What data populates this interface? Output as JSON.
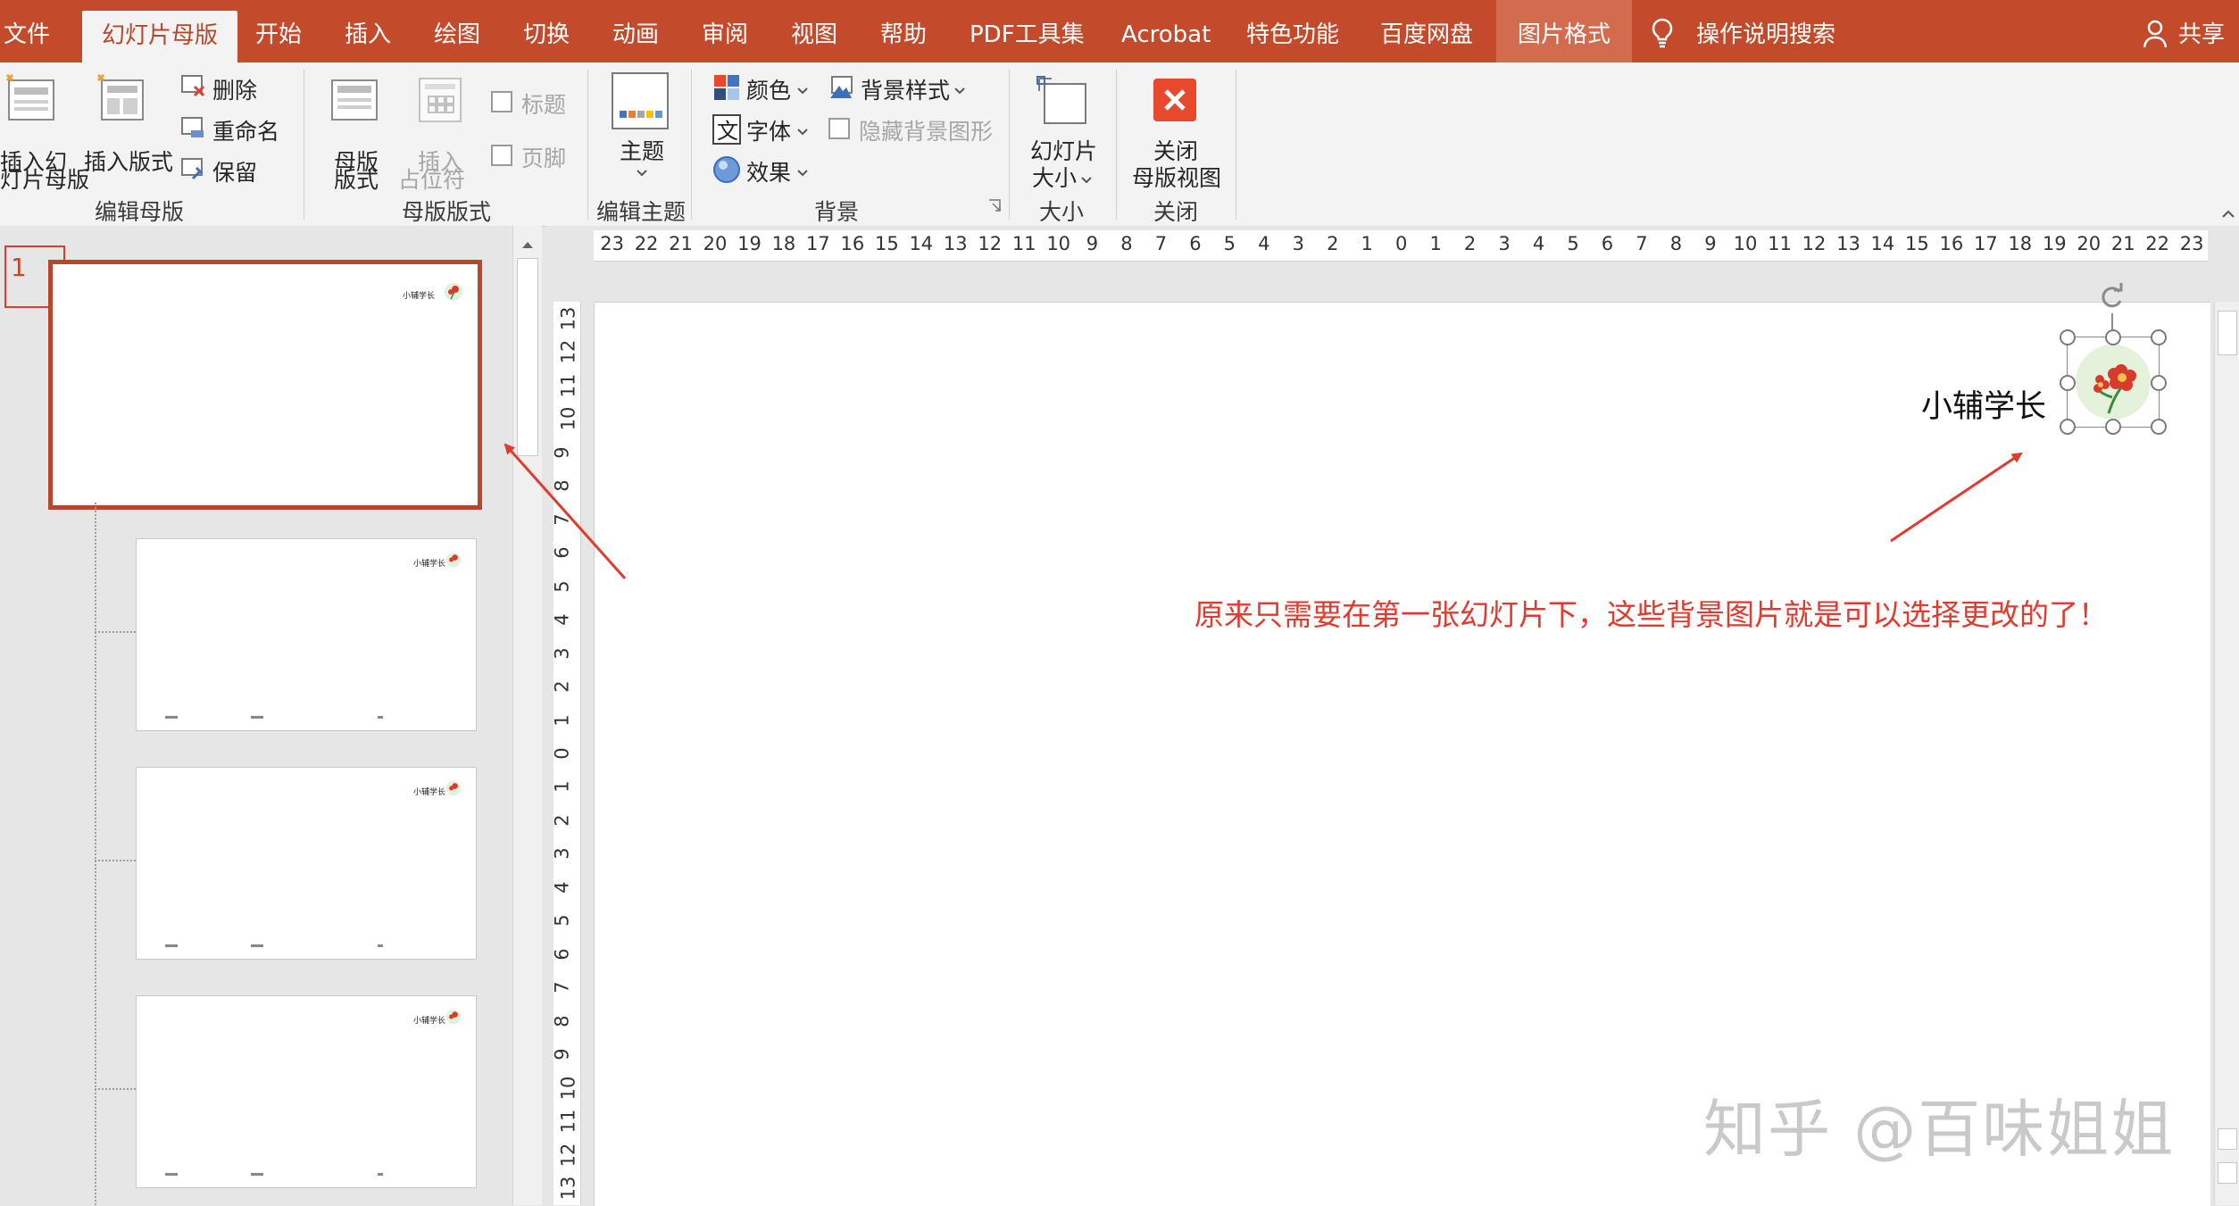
{
  "tabs": {
    "file": "文件",
    "slide_master": "幻灯片母版",
    "home": "开始",
    "insert": "插入",
    "draw": "绘图",
    "transitions": "切换",
    "animations": "动画",
    "review": "审阅",
    "view": "视图",
    "help": "帮助",
    "pdf_tools": "PDF工具集",
    "acrobat": "Acrobat",
    "special": "特色功能",
    "baidu": "百度网盘",
    "picture_format": "图片格式",
    "tell_me": "操作说明搜索",
    "share": "共享"
  },
  "ribbon": {
    "edit_master": {
      "insert_slide_master_line1": "插入幻",
      "insert_slide_master_line2": "灯片母版",
      "insert_layout": "插入版式",
      "delete": "删除",
      "rename": "重命名",
      "preserve": "保留",
      "group": "编辑母版"
    },
    "master_layout": {
      "master_layout_line1": "母版",
      "master_layout_line2": "版式",
      "insert_placeholder_line1": "插入",
      "insert_placeholder_line2": "占位符",
      "title": "标题",
      "footer": "页脚",
      "group": "母版版式"
    },
    "edit_theme": {
      "themes": "主题",
      "group": "编辑主题"
    },
    "background": {
      "colors": "颜色",
      "fonts": "字体",
      "effects": "效果",
      "background_styles": "背景样式",
      "hide_background_graphics": "隐藏背景图形",
      "group": "背景"
    },
    "size": {
      "slide_size_line1": "幻灯片",
      "slide_size_line2": "大小",
      "group": "大小"
    },
    "close": {
      "close_line1": "关闭",
      "close_line2": "母版视图",
      "group": "关闭"
    }
  },
  "thumbnails": {
    "master_number": "1",
    "master_text": "小辅学长",
    "layout_text": "小辅学长",
    "count": 4
  },
  "rulers": {
    "horizontal": [
      "23",
      "22",
      "21",
      "20",
      "19",
      "18",
      "17",
      "16",
      "15",
      "14",
      "13",
      "12",
      "11",
      "10",
      "9",
      "8",
      "7",
      "6",
      "5",
      "4",
      "3",
      "2",
      "1",
      "0",
      "1",
      "2",
      "3",
      "4",
      "5",
      "6",
      "7",
      "8",
      "9",
      "10",
      "11",
      "12",
      "13",
      "14",
      "15",
      "16",
      "17",
      "18",
      "19",
      "20",
      "21",
      "22",
      "23"
    ],
    "vertical": [
      "13",
      "12",
      "11",
      "10",
      "9",
      "8",
      "7",
      "6",
      "5",
      "4",
      "3",
      "2",
      "1",
      "0",
      "1",
      "2",
      "3",
      "4",
      "5",
      "6",
      "7",
      "8",
      "9",
      "10",
      "11",
      "12",
      "13"
    ]
  },
  "slide": {
    "brand_text": "小辅学长",
    "annotation": "原来只需要在第一张幻灯片下，这些背景图片就是可以选择更改的了！",
    "watermark": "知乎 @百味姐姐"
  },
  "colors": {
    "accent": "#c34b2c",
    "annotation": "#e23a2e",
    "close_button": "#e8492c"
  }
}
